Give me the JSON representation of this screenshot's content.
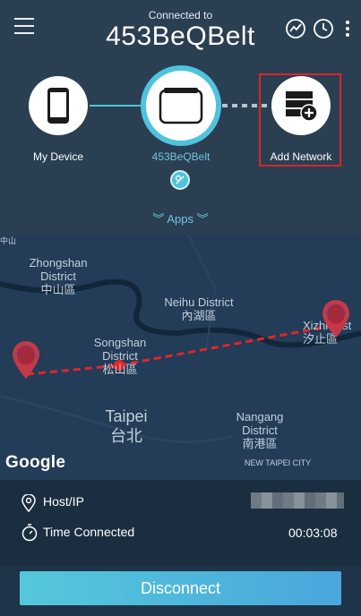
{
  "header": {
    "connected_to_label": "Connected to",
    "device_name": "453BeQBelt"
  },
  "nodes": {
    "my_device_label": "My Device",
    "nas_label": "453BeQBelt",
    "add_network_label": "Add Network"
  },
  "apps_label": "Apps",
  "map": {
    "labels": [
      {
        "en": "Zhongshan District",
        "zh": "中山區"
      },
      {
        "en": "Neihu District",
        "zh": "內湖區"
      },
      {
        "en": "Songshan District",
        "zh": "松山區"
      },
      {
        "en": "Taipei",
        "zh": "台北"
      },
      {
        "en": "Nangang District",
        "zh": "南港區"
      },
      {
        "en": "Xizhi Dist",
        "zh": "汐止區"
      }
    ],
    "new_taipei_label": "NEW TAIPEI CITY",
    "google_logo": "Google",
    "corner_glyph": "中山"
  },
  "info": {
    "host_label": "Host/IP",
    "time_label": "Time Connected",
    "time_value": "00:03:08"
  },
  "disconnect_label": "Disconnect",
  "colors": {
    "accent": "#4fc3dd",
    "highlight_border": "#e0262b",
    "route": "#e0262b"
  }
}
